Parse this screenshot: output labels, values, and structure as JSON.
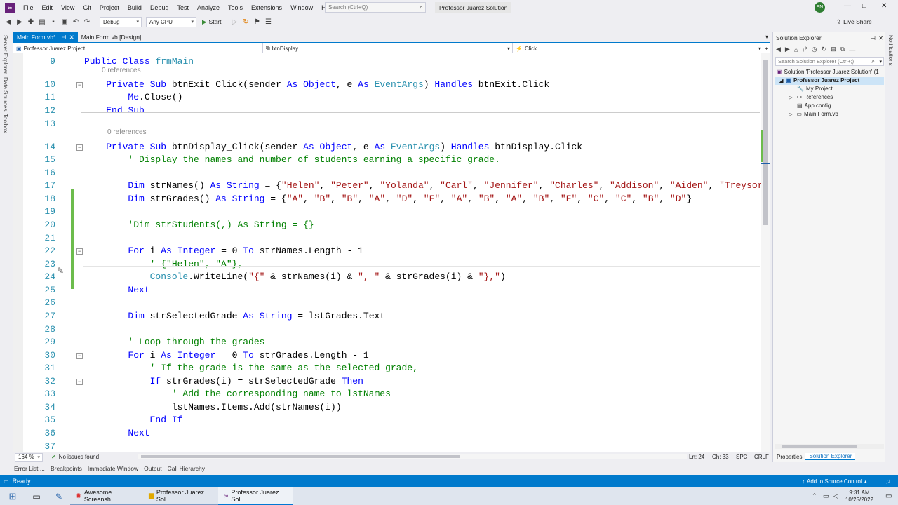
{
  "menu": [
    "File",
    "Edit",
    "View",
    "Git",
    "Project",
    "Build",
    "Debug",
    "Test",
    "Analyze",
    "Tools",
    "Extensions",
    "Window",
    "Help"
  ],
  "search_placeholder": "Search (Ctrl+Q)",
  "solution_title": "Professor Juarez Solution",
  "user_initials": "EN",
  "live_share": "Live Share",
  "toolbar": {
    "config": "Debug",
    "platform": "Any CPU",
    "start": "Start"
  },
  "left_strip": [
    "Server Explorer",
    "Data Sources",
    "Toolbox"
  ],
  "right_strip": [
    "Notifications"
  ],
  "doc_tabs": [
    {
      "label": "Main Form.vb*",
      "active": true
    },
    {
      "label": "Main Form.vb [Design]",
      "active": false
    }
  ],
  "nav": {
    "project": "Professor Juarez Project",
    "object": "btnDisplay",
    "event": "Click"
  },
  "code_lines": [
    {
      "n": "9",
      "html": "<span class=\"kw\">Public</span> <span class=\"kw\">Class</span> <span class=\"ty\">frmMain</span>"
    },
    {
      "n": "10",
      "html": "    <span class=\"kw\">Private</span> <span class=\"kw\">Sub</span> btnExit_Click(sender <span class=\"kw\">As</span> <span class=\"kw\">Object</span>, e <span class=\"kw\">As</span> <span class=\"ty\">EventArgs</span>) <span class=\"kw\">Handles</span> btnExit.Click"
    },
    {
      "n": "11",
      "html": "        <span class=\"kw\">Me</span>.Close()"
    },
    {
      "n": "12",
      "html": "    <span class=\"kw\">End</span> <span class=\"kw\">Sub</span>"
    },
    {
      "n": "13",
      "html": ""
    },
    {
      "n": "14",
      "html": "    <span class=\"kw\">Private</span> <span class=\"kw\">Sub</span> btnDisplay_Click(sender <span class=\"kw\">As</span> <span class=\"kw\">Object</span>, e <span class=\"kw\">As</span> <span class=\"ty\">EventArgs</span>) <span class=\"kw\">Handles</span> btnDisplay.Click"
    },
    {
      "n": "15",
      "html": "        <span class=\"cm\">' Display the names and number of students earning a specific grade.</span>"
    },
    {
      "n": "16",
      "html": ""
    },
    {
      "n": "17",
      "html": "        <span class=\"kw\">Dim</span> strNames() <span class=\"kw\">As</span> <span class=\"kw\">String</span> = {<span class=\"st\">\"Helen\"</span>, <span class=\"st\">\"Peter\"</span>, <span class=\"st\">\"Yolanda\"</span>, <span class=\"st\">\"Carl\"</span>, <span class=\"st\">\"Jennifer\"</span>, <span class=\"st\">\"Charles\"</span>, <span class=\"st\">\"Addison\"</span>, <span class=\"st\">\"Aiden\"</span>, <span class=\"st\">\"Treysor</span>"
    },
    {
      "n": "18",
      "html": "        <span class=\"kw\">Dim</span> strGrades() <span class=\"kw\">As</span> <span class=\"kw\">String</span> = {<span class=\"st\">\"A\"</span>, <span class=\"st\">\"B\"</span>, <span class=\"st\">\"B\"</span>, <span class=\"st\">\"A\"</span>, <span class=\"st\">\"D\"</span>, <span class=\"st\">\"F\"</span>, <span class=\"st\">\"A\"</span>, <span class=\"st\">\"B\"</span>, <span class=\"st\">\"A\"</span>, <span class=\"st\">\"B\"</span>, <span class=\"st\">\"F\"</span>, <span class=\"st\">\"C\"</span>, <span class=\"st\">\"C\"</span>, <span class=\"st\">\"B\"</span>, <span class=\"st\">\"D\"</span>}"
    },
    {
      "n": "19",
      "html": ""
    },
    {
      "n": "20",
      "html": "        <span class=\"cm\">'Dim strStudents(,) As String = {}</span>"
    },
    {
      "n": "21",
      "html": ""
    },
    {
      "n": "22",
      "html": "        <span class=\"kw\">For</span> i <span class=\"kw\">As</span> <span class=\"kw\">Integer</span> = 0 <span class=\"kw\">To</span> strNames.Length - 1"
    },
    {
      "n": "23",
      "html": "            <span class=\"cm\">' {\"Helen\", \"A\"},</span>"
    },
    {
      "n": "24",
      "html": "            <span class=\"ty\">Console</span>.WriteLine(<span class=\"st\">\"{\"</span> &amp; strNames(i) &amp; <span class=\"st\">\", \"</span> &amp; strGrades(i) &amp; <span class=\"st\">\"},\"</span>)"
    },
    {
      "n": "25",
      "html": "        <span class=\"kw\">Next</span>"
    },
    {
      "n": "26",
      "html": ""
    },
    {
      "n": "27",
      "html": "        <span class=\"kw\">Dim</span> strSelectedGrade <span class=\"kw\">As</span> <span class=\"kw\">String</span> = lstGrades.Text"
    },
    {
      "n": "28",
      "html": ""
    },
    {
      "n": "29",
      "html": "        <span class=\"cm\">' Loop through the grades</span>"
    },
    {
      "n": "30",
      "html": "        <span class=\"kw\">For</span> i <span class=\"kw\">As</span> <span class=\"kw\">Integer</span> = 0 <span class=\"kw\">To</span> strGrades.Length - 1"
    },
    {
      "n": "31",
      "html": "            <span class=\"cm\">' If the grade is the same as the selected grade,</span>"
    },
    {
      "n": "32",
      "html": "            <span class=\"kw\">If</span> strGrades(i) = strSelectedGrade <span class=\"kw\">Then</span>"
    },
    {
      "n": "33",
      "html": "                <span class=\"cm\">' Add the corresponding name to lstNames</span>"
    },
    {
      "n": "34",
      "html": "                lstNames.Items.Add(strNames(i))"
    },
    {
      "n": "35",
      "html": "            <span class=\"kw\">End</span> <span class=\"kw\">If</span>"
    },
    {
      "n": "36",
      "html": "        <span class=\"kw\">Next</span>"
    },
    {
      "n": "37",
      "html": ""
    }
  ],
  "references_label": "0 references",
  "status": {
    "zoom": "164 %",
    "issues": "No issues found",
    "ln": "Ln: 24",
    "ch": "Ch: 33",
    "spc": "SPC",
    "crlf": "CRLF"
  },
  "bottom_tabs": [
    "Error List ...",
    "Breakpoints",
    "Immediate Window",
    "Output",
    "Call Hierarchy"
  ],
  "statusbar": {
    "ready": "Ready",
    "source_control": "Add to Source Control"
  },
  "solution_explorer": {
    "title": "Solution Explorer",
    "search_placeholder": "Search Solution Explorer (Ctrl+;)",
    "solution": "Solution 'Professor Juarez Solution' (1",
    "project": "Professor Juarez Project",
    "items": [
      "My Project",
      "References",
      "App.config",
      "Main Form.vb"
    ],
    "tabs": [
      "Properties",
      "Solution Explorer"
    ]
  },
  "taskbar": {
    "apps": [
      "Awesome Screensh...",
      "Professor Juarez Sol...",
      "Professor Juarez Sol..."
    ],
    "time": "9:31 AM",
    "date": "10/25/2022"
  },
  "colors": {
    "accent": "#007acc",
    "keyword": "#0000ff",
    "type": "#2b91af",
    "string": "#a31515",
    "comment": "#008000",
    "vs_purple": "#68217a"
  }
}
